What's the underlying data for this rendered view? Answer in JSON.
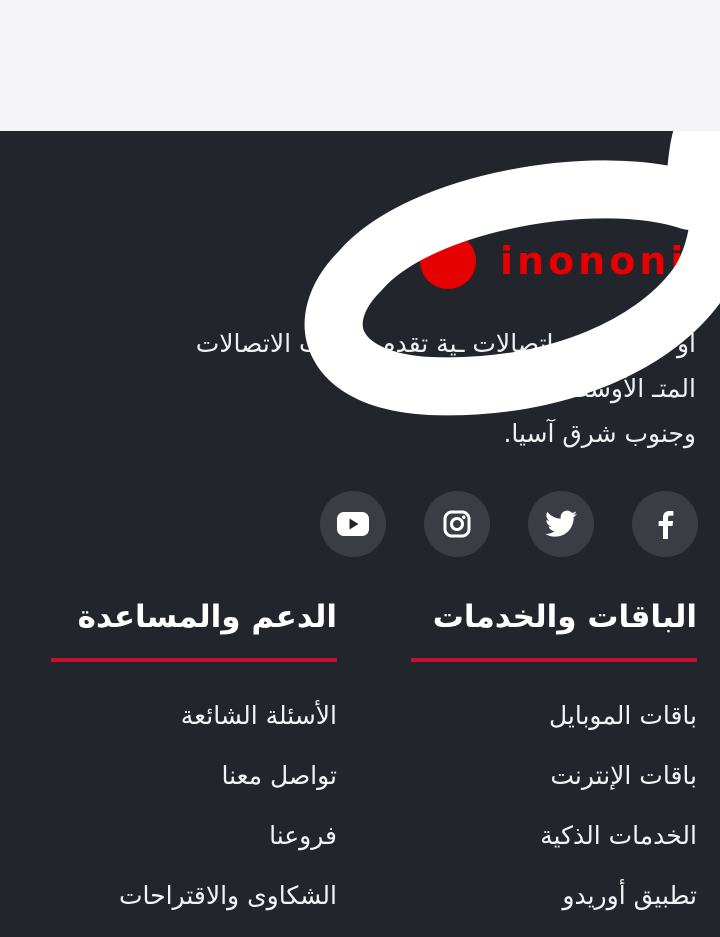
{
  "brand": {
    "logo_text": "inononi"
  },
  "about": {
    "lines": [
      "أو  ـهي شركة اتصالات  ـية تقدم خدمات الاتصالات",
      "المتـ                                  الأوسط وشمال أفريقيا",
      "وجنوب شرق آسيا."
    ]
  },
  "socials": [
    {
      "name": "facebook",
      "icon": "facebook-icon"
    },
    {
      "name": "twitter",
      "icon": "twitter-icon"
    },
    {
      "name": "instagram",
      "icon": "instagram-icon"
    },
    {
      "name": "youtube",
      "icon": "youtube-icon"
    }
  ],
  "columns": {
    "packages": {
      "title": "الباقات والخدمات",
      "items": [
        "باقات الموبايل",
        "باقات الإنترنت",
        "الخدمات الذكية",
        "تطبيق أوريدو"
      ]
    },
    "support": {
      "title": "الدعم والمساعدة",
      "items": [
        "الأسئلة الشائعة",
        "تواصل معنا",
        "فروعنا",
        "الشكاوى والاقتراحات"
      ]
    }
  },
  "colors": {
    "background": "#22252b",
    "accent": "#e60000",
    "rule": "#c8102e",
    "top_band": "#f5f5f7"
  }
}
